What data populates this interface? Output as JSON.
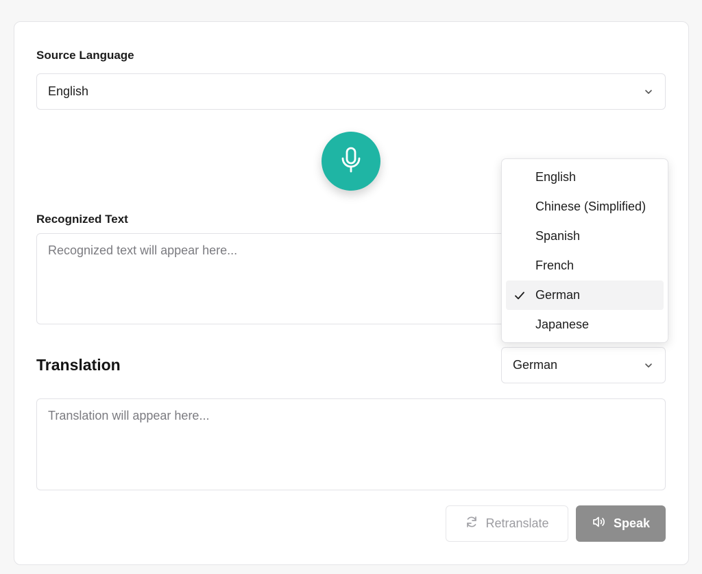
{
  "source": {
    "label": "Source Language",
    "selected": "English"
  },
  "recognized": {
    "label": "Recognized Text",
    "placeholder": "Recognized text will appear here..."
  },
  "translation": {
    "title": "Translation",
    "selected": "German",
    "placeholder": "Translation will appear here..."
  },
  "actions": {
    "retranslate_label": "Retranslate",
    "speak_label": "Speak"
  },
  "dropdown": {
    "options": [
      "English",
      "Chinese (Simplified)",
      "Spanish",
      "French",
      "German",
      "Japanese"
    ],
    "selected_index": 4
  },
  "colors": {
    "accent": "#1fb5a4",
    "speak_button": "#8d8d8d"
  },
  "icons": {
    "mic": "microphone-icon",
    "chevron": "chevron-down-icon",
    "check": "check-icon",
    "retranslate": "refresh-icon",
    "speak": "speaker-icon"
  }
}
